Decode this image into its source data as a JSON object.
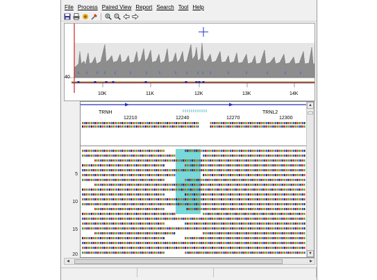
{
  "menu": [
    "File",
    "Process",
    "Paired View",
    "Report",
    "Search",
    "Tool",
    "Help"
  ],
  "toolbar_icons": [
    "save-icon",
    "print-icon",
    "record-icon",
    "tools-icon",
    "zoom-in-icon",
    "zoom-out-icon",
    "back-arrow-icon",
    "forward-arrow-icon"
  ],
  "overview": {
    "y_tick": "40",
    "x_ticks": [
      "10K",
      "11K",
      "12K",
      "13K",
      "14K"
    ]
  },
  "detail": {
    "genes": [
      "TRNH",
      "TRNL2"
    ],
    "positions": [
      "12210",
      "12240",
      "12270",
      "12300"
    ],
    "row_numbers": [
      "5",
      "10",
      "15",
      "20"
    ]
  }
}
